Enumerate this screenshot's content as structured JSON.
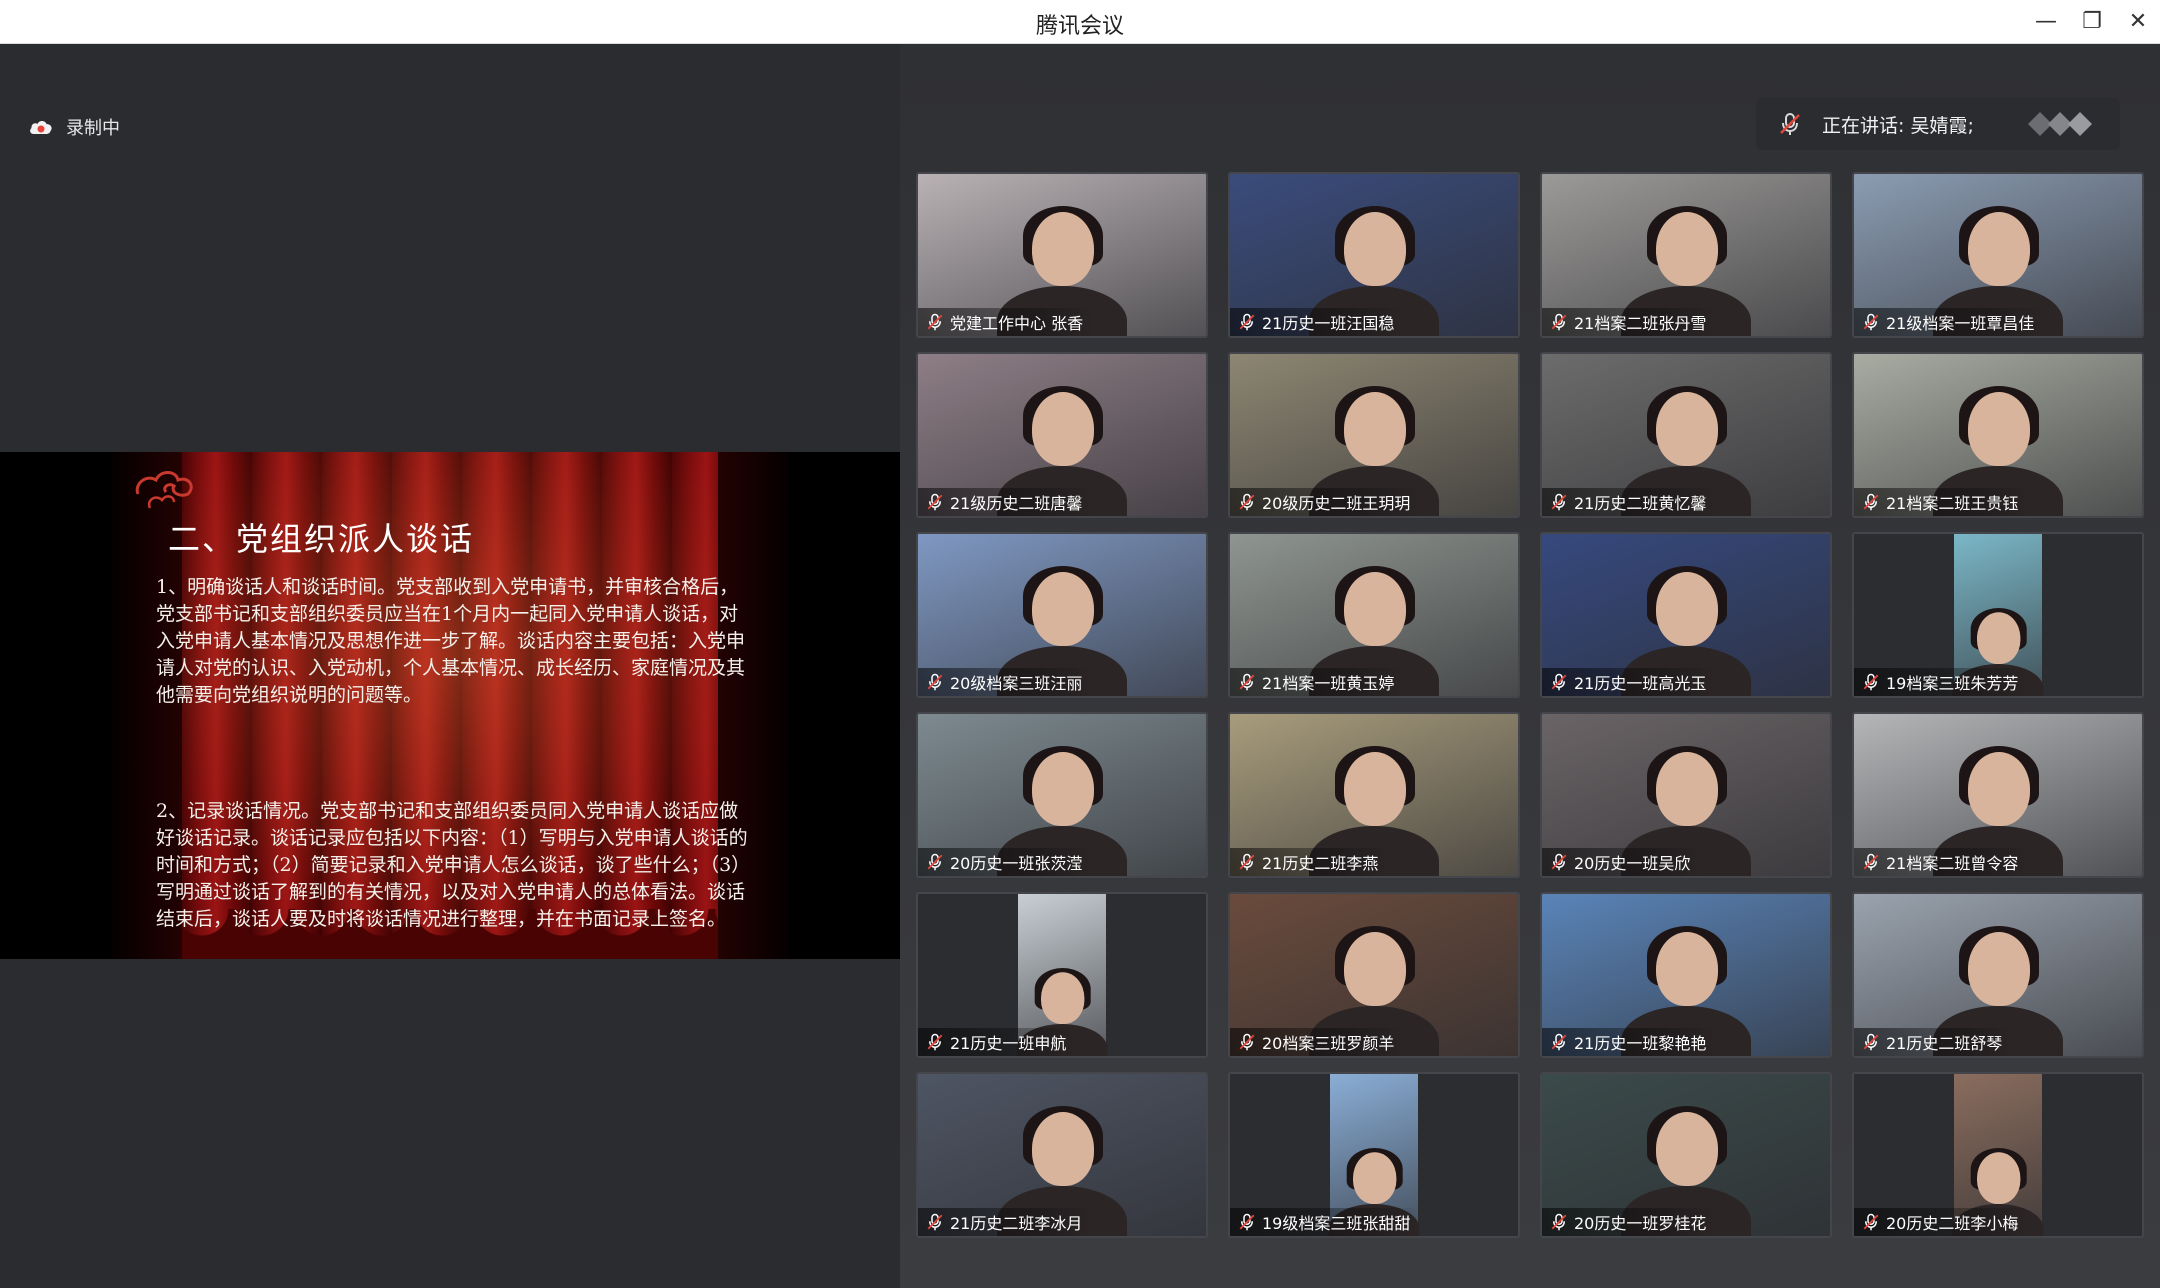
{
  "window": {
    "title": "腾讯会议"
  },
  "recording": {
    "label": "录制中"
  },
  "speaking": {
    "label": "正在讲话: 吴婧霞;"
  },
  "slide": {
    "title": "二、党组织派人谈话",
    "paragraph1": "1、明确谈话人和谈话时间。党支部收到入党申请书，并审核合格后，党支部书记和支部组织委员应当在1个月内一起同入党申请人谈话，对入党申请人基本情况及思想作进一步了解。谈话内容主要包括：入党申请人对党的认识、入党动机，个人基本情况、成长经历、家庭情况及其他需要向党组织说明的问题等。",
    "paragraph2": "2、记录谈话情况。党支部书记和支部组织委员同入党申请人谈话应做好谈话记录。谈话记录应包括以下内容：（1）写明与入党申请人谈话的时间和方式；（2）简要记录和入党申请人怎么谈话，谈了些什么；（3）写明通过谈话了解到的有关情况，以及对入党申请人的总体看法。谈话结束后，谈话人要及时将谈话情况进行整理，并在书面记录上签名。"
  },
  "participants": [
    {
      "name": "党建工作中心 张香",
      "bg": "#b9b2b5"
    },
    {
      "name": "21历史一班汪国稳",
      "bg": "#3a4c7c"
    },
    {
      "name": "21档案二班张丹雪",
      "bg": "#9c9a98"
    },
    {
      "name": "21级档案一班覃昌佳",
      "bg": "#8b9cb2"
    },
    {
      "name": "21级历史二班唐馨",
      "bg": "#8e7e86"
    },
    {
      "name": "20级历史二班王玥玥",
      "bg": "#8d8672"
    },
    {
      "name": "21历史二班黄忆馨",
      "bg": "#6c6c6c"
    },
    {
      "name": "21档案二班王贵钰",
      "bg": "#a8aca2"
    },
    {
      "name": "20级档案三班汪丽",
      "bg": "#7f98c2"
    },
    {
      "name": "21档案一班黄玉婷",
      "bg": "#8f9590"
    },
    {
      "name": "21历史一班高光玉",
      "bg": "#36497e"
    },
    {
      "name": "19档案三班朱芳芳",
      "bg": "#7bb7c7",
      "narrow": true
    },
    {
      "name": "20历史一班张茨滢",
      "bg": "#7d8a90"
    },
    {
      "name": "21历史二班李燕",
      "bg": "#a89c7c"
    },
    {
      "name": "20历史一班吴欣",
      "bg": "#6a6466"
    },
    {
      "name": "21档案二班曾令容",
      "bg": "#b4b6b8"
    },
    {
      "name": "21历史一班申航",
      "bg": "#c8cfd4",
      "narrow": true
    },
    {
      "name": "20档案三班罗颜羊",
      "bg": "#6a4b3c"
    },
    {
      "name": "21历史一班黎艳艳",
      "bg": "#5a84b8"
    },
    {
      "name": "21历史二班舒琴",
      "bg": "#9aa3ae"
    },
    {
      "name": "21历史二班李冰月",
      "bg": "#4e5563"
    },
    {
      "name": "19级档案三班张甜甜",
      "bg": "#8aaed6",
      "narrow": true
    },
    {
      "name": "20历史一班罗桂花",
      "bg": "#3b4a4a"
    },
    {
      "name": "20历史二班李小梅",
      "bg": "#8a6d5e",
      "narrow": true
    }
  ]
}
